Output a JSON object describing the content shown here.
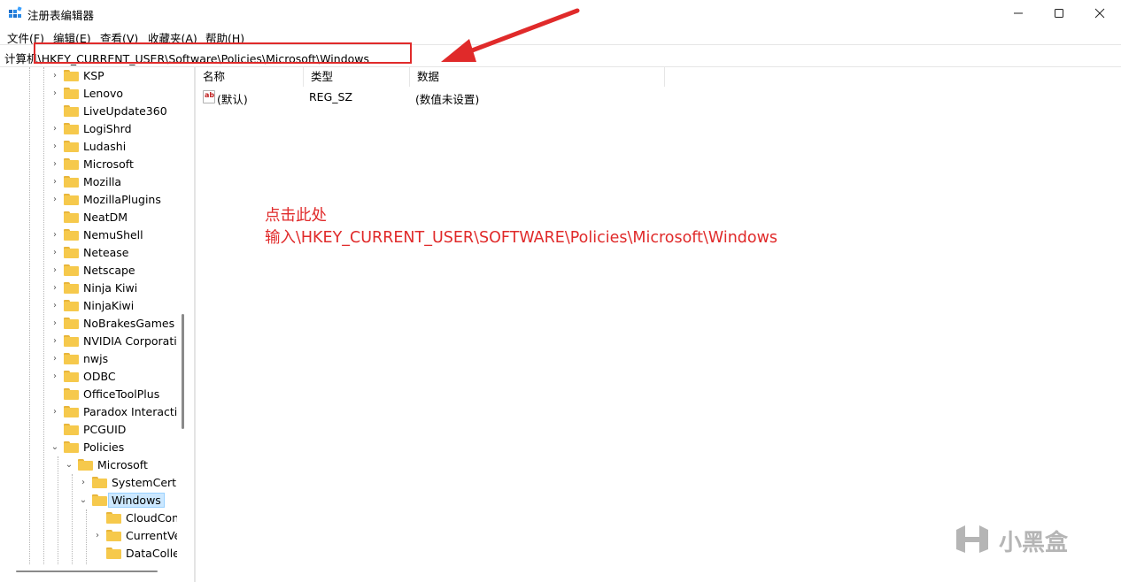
{
  "window": {
    "title": "注册表编辑器",
    "controls": {
      "minimize": "minimize-icon",
      "maximize": "maximize-icon",
      "close": "close-icon"
    }
  },
  "menu": [
    {
      "label": "文件(F)"
    },
    {
      "label": "编辑(E)"
    },
    {
      "label": "查看(V)"
    },
    {
      "label": "收藏夹(A)"
    },
    {
      "label": "帮助(H)"
    }
  ],
  "address": {
    "value": "计算机\\HKEY_CURRENT_USER\\Software\\Policies\\Microsoft\\Windows"
  },
  "tree": {
    "items": [
      {
        "label": "KSP",
        "expander": "›"
      },
      {
        "label": "Lenovo",
        "expander": "›"
      },
      {
        "label": "LiveUpdate360",
        "expander": ""
      },
      {
        "label": "LogiShrd",
        "expander": "›"
      },
      {
        "label": "Ludashi",
        "expander": "›"
      },
      {
        "label": "Microsoft",
        "expander": "›"
      },
      {
        "label": "Mozilla",
        "expander": "›"
      },
      {
        "label": "MozillaPlugins",
        "expander": "›"
      },
      {
        "label": "NeatDM",
        "expander": ""
      },
      {
        "label": "NemuShell",
        "expander": "›"
      },
      {
        "label": "Netease",
        "expander": "›"
      },
      {
        "label": "Netscape",
        "expander": "›"
      },
      {
        "label": "Ninja Kiwi",
        "expander": "›"
      },
      {
        "label": "NinjaKiwi",
        "expander": "›"
      },
      {
        "label": "NoBrakesGames",
        "expander": "›"
      },
      {
        "label": "NVIDIA Corporatio",
        "expander": "›"
      },
      {
        "label": "nwjs",
        "expander": "›"
      },
      {
        "label": "ODBC",
        "expander": "›"
      },
      {
        "label": "OfficeToolPlus",
        "expander": ""
      },
      {
        "label": "Paradox Interactiv",
        "expander": "›"
      },
      {
        "label": "PCGUID",
        "expander": ""
      },
      {
        "label": "Policies",
        "expander": "⌄"
      },
      {
        "label": "Microsoft",
        "expander": "⌄"
      },
      {
        "label": "SystemCertifi",
        "expander": "›"
      },
      {
        "label": "Windows",
        "expander": "⌄"
      },
      {
        "label": "CloudCont",
        "expander": ""
      },
      {
        "label": "CurrentVe",
        "expander": "›"
      },
      {
        "label": "DataCollec",
        "expander": ""
      }
    ]
  },
  "list": {
    "columns": [
      "名称",
      "类型",
      "数据"
    ],
    "rows": [
      {
        "icon": "string-value-icon",
        "icon_text": "ab",
        "name": "(默认)",
        "type": "REG_SZ",
        "data": "(数值未设置)"
      }
    ]
  },
  "annotation": {
    "line1": "点击此处",
    "line2": "输入\\HKEY_CURRENT_USER\\SOFTWARE\\Policies\\Microsoft\\Windows",
    "color": "#e02a2a"
  },
  "watermark": {
    "text": "小黑盒"
  }
}
